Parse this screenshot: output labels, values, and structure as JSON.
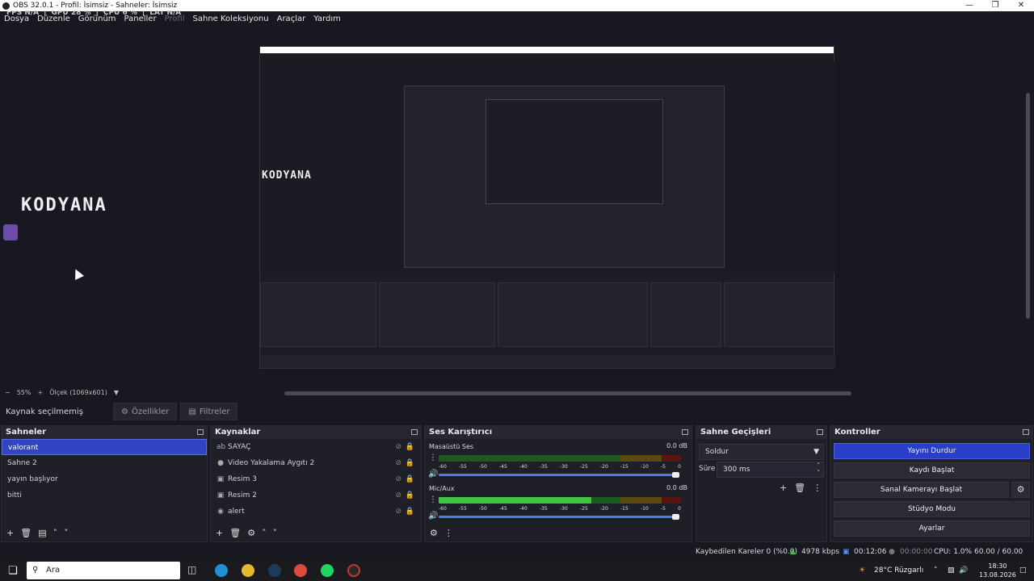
{
  "window": {
    "title": "OBS 32.0.1 - Profil: İsimsiz - Sahneler: İsimsiz"
  },
  "stats_overlay": [
    "FPS N/A",
    "GPU 28 %",
    "CPU 6 %",
    "LAT N/A"
  ],
  "menu": [
    "Dosya",
    "Düzenle",
    "Görünüm",
    "Paneller",
    "Profil",
    "Sahne Koleksiyonu",
    "Araçlar",
    "Yardım"
  ],
  "preview": {
    "logo_text": "KODYANA",
    "zoom": "55%",
    "scale_label": "Ölçek (1069x601)"
  },
  "props_bar": {
    "no_source": "Kaynak seçilmemiş",
    "properties": "Özellikler",
    "filters": "Filtreler"
  },
  "scenes": {
    "title": "Sahneler",
    "items": [
      "valorant",
      "Sahne 2",
      "yayın başlıyor",
      "bitti"
    ]
  },
  "sources": {
    "title": "Kaynaklar",
    "items": [
      {
        "icon": "ab",
        "label": "SAYAÇ"
      },
      {
        "icon": "camera",
        "label": "Video Yakalama Aygıtı 2"
      },
      {
        "icon": "image",
        "label": "Resim 3"
      },
      {
        "icon": "image",
        "label": "Resim 2"
      },
      {
        "icon": "globe",
        "label": "alert"
      }
    ]
  },
  "mixer": {
    "title": "Ses Karıştırıcı",
    "channels": [
      {
        "name": "Masaüstü Ses",
        "db": "0.0 dB",
        "level": 0.0
      },
      {
        "name": "Mic/Aux",
        "db": "0.0 dB",
        "level": 0.63
      }
    ],
    "ticks": [
      "-60",
      "-55",
      "-50",
      "-45",
      "-40",
      "-35",
      "-30",
      "-25",
      "-20",
      "-15",
      "-10",
      "-5",
      "0"
    ]
  },
  "transitions": {
    "title": "Sahne Geçişleri",
    "selected": "Soldur",
    "duration_label": "Süre",
    "duration_value": "300 ms"
  },
  "controls": {
    "title": "Kontroller",
    "buttons": [
      "Yayını Durdur",
      "Kaydı Başlat",
      "Sanal Kamerayı Başlat",
      "Stüdyo Modu",
      "Ayarlar"
    ]
  },
  "status": {
    "dropped": "Kaybedilen Kareler 0 (%0.0)",
    "bitrate": "4978 kbps",
    "stream_time": "00:12:06",
    "rec_time": "00:00:00",
    "cpu": "CPU: 1.0%",
    "fps": "60.00 / 60.00 FPS"
  },
  "taskbar": {
    "search": "Ara",
    "weather": "28°C Rüzgarlı",
    "time": "18:30",
    "date": "13.08.2026"
  },
  "colors": {
    "accent": "#3044c4",
    "meter_green": "#3ec43e",
    "meter_yellow": "#d8b42c",
    "meter_red": "#c42c2c"
  }
}
